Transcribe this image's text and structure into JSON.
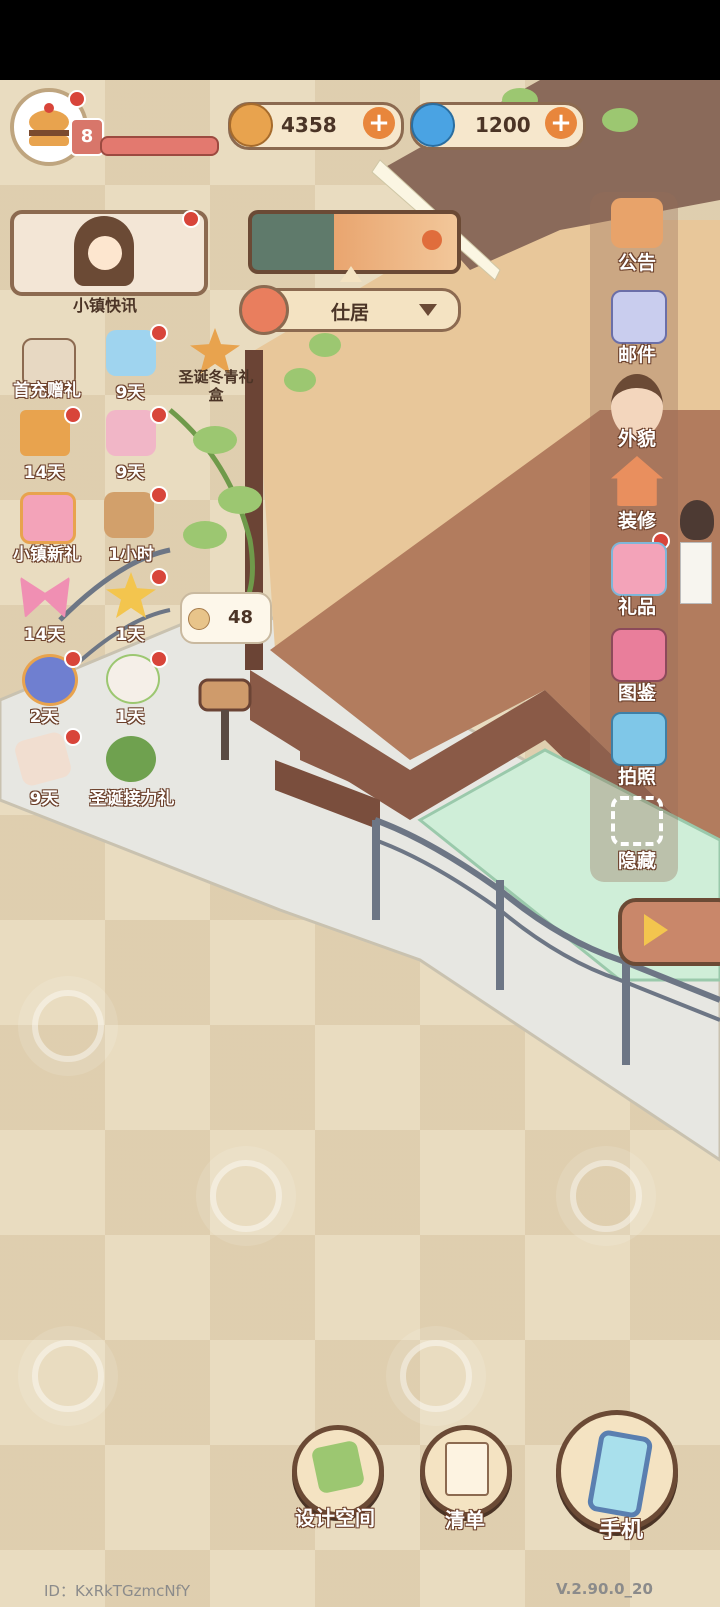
{
  "player": {
    "level": "8",
    "avatar_icon": "burger-icon"
  },
  "currencies": [
    {
      "name": "coin",
      "value": "4358",
      "icon": "coin-icon"
    },
    {
      "name": "gem",
      "value": "1200",
      "icon": "swirl-gem-icon"
    }
  ],
  "news": {
    "label": "小镇快讯"
  },
  "location": {
    "label": "仕居"
  },
  "left_gifts": [
    {
      "label": "首充赠礼",
      "icon": "envelope-gift-icon"
    },
    {
      "label": "9天",
      "icon": "blue-flower-box-icon"
    },
    {
      "label": "圣诞冬青礼盒",
      "icon": "christmas-star-box-icon"
    },
    {
      "label": "14天",
      "icon": "golden-trophy-icon"
    },
    {
      "label": "9天",
      "icon": "pink-bow-flower-icon"
    },
    {
      "label": "小镇新礼",
      "icon": "rose-badge-icon"
    },
    {
      "label": "1小时",
      "icon": "strawberry-cake-icon"
    },
    {
      "label": "14天",
      "icon": "pink-bow-icon"
    },
    {
      "label": "1天",
      "icon": "star-bow-icon"
    },
    {
      "label": "2天",
      "icon": "blue-trophy-icon"
    },
    {
      "label": "1天",
      "icon": "cotton-flower-icon"
    },
    {
      "label": "9天",
      "icon": "letter-icon"
    },
    {
      "label": "圣诞接力礼",
      "icon": "berry-wreath-icon"
    }
  ],
  "mailbox_coins": "48",
  "side_menu": [
    {
      "label": "公告",
      "icon": "megaphone-icon"
    },
    {
      "label": "邮件",
      "icon": "mail-icon"
    },
    {
      "label": "外貌",
      "icon": "face-icon"
    },
    {
      "label": "装修",
      "icon": "house-wrench-icon"
    },
    {
      "label": "礼品",
      "icon": "gift-box-icon"
    },
    {
      "label": "图鉴",
      "icon": "book-icon"
    },
    {
      "label": "拍照",
      "icon": "camera-icon"
    },
    {
      "label": "隐藏",
      "icon": "hide-frame-icon"
    }
  ],
  "bottom": {
    "design_label": "设计空间",
    "list_label": "清单",
    "phone_label": "手机"
  },
  "footer": {
    "id": "ID：KxRkTGzmcNfY",
    "version": "V.2.90.0_20"
  }
}
